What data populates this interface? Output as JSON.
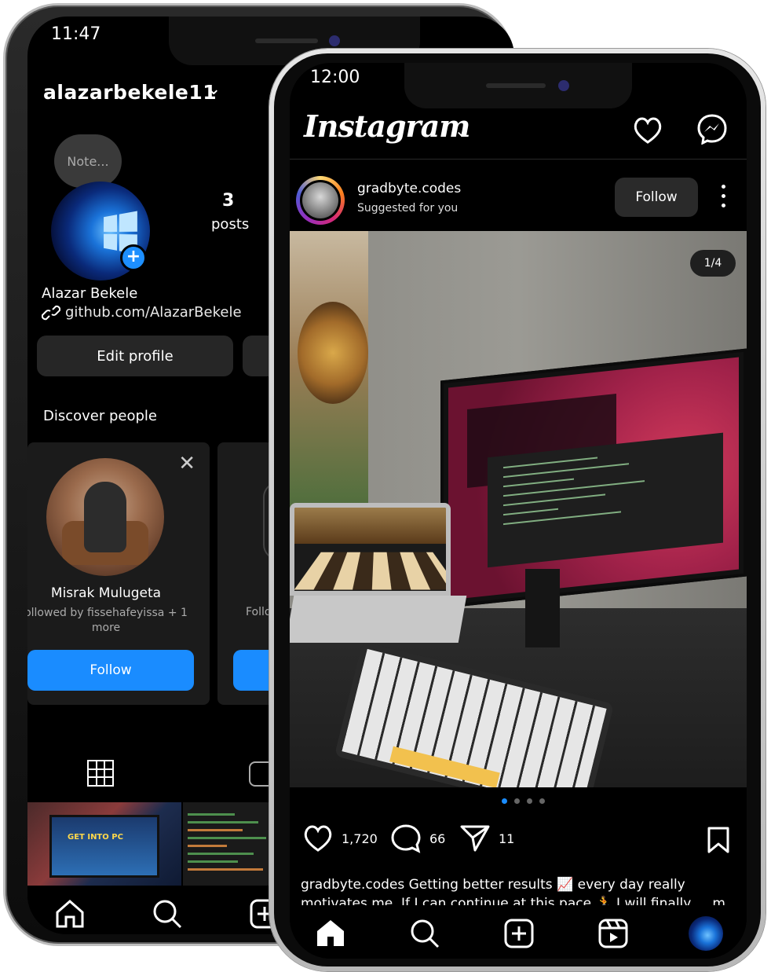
{
  "back_phone": {
    "status": {
      "time": "11:47"
    },
    "username": "alazarbekele11",
    "note": "Note...",
    "posts_count": "3",
    "posts_label": "posts",
    "display_name": "Alazar Bekele",
    "link": "github.com/AlazarBekele",
    "edit_profile_label": "Edit profile",
    "discover_label": "Discover people",
    "suggestions": [
      {
        "name": "Misrak Mulugeta",
        "subtitle": "ollowed by fissehafeyissa + 1 more",
        "follow_label": "Follow"
      },
      {
        "name": "",
        "subtitle": "Follo",
        "follow_label": ""
      }
    ],
    "thumb_text": "GET INTO PC"
  },
  "front_phone": {
    "status": {
      "time": "12:00"
    },
    "app_title": "Instagram",
    "post": {
      "username": "gradbyte.codes",
      "subtitle": "Suggested for you",
      "follow_label": "Follow",
      "counter": "1/4",
      "likes": "1,720",
      "comments": "66",
      "shares": "11",
      "caption_line1": "gradbyte.codes Getting better results 📈 every day really",
      "caption_line2": "motivates me. If I can continue at this pace 🏃 I will finally ... more"
    }
  },
  "colors": {
    "accent_blue": "#1a8cff",
    "background": "#000000",
    "button_dark": "#262626"
  }
}
